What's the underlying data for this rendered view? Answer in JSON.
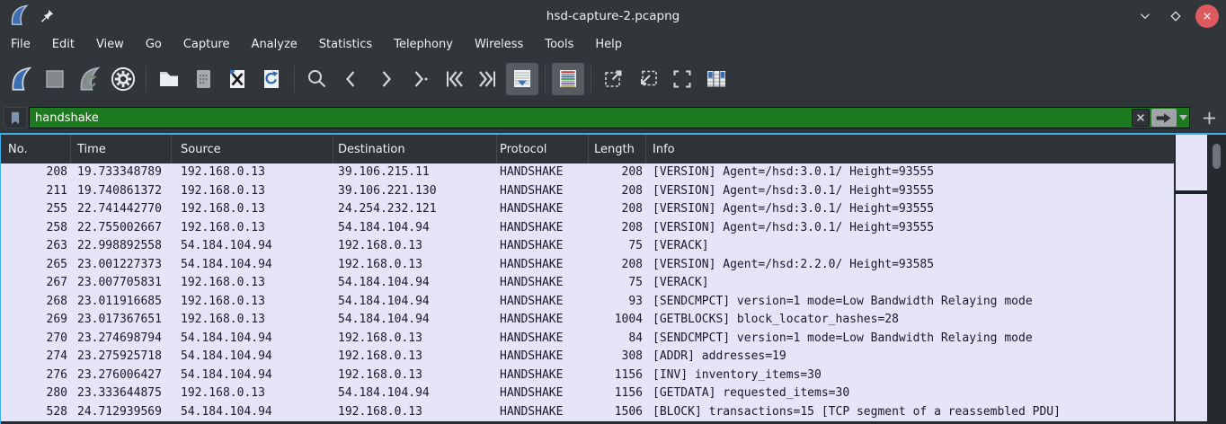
{
  "window": {
    "title": "hsd-capture-2.pcapng",
    "controls": [
      "minimize-icon",
      "maximize-icon",
      "close-icon"
    ]
  },
  "menu": {
    "items": [
      "File",
      "Edit",
      "View",
      "Go",
      "Capture",
      "Analyze",
      "Statistics",
      "Telephony",
      "Wireless",
      "Tools",
      "Help"
    ]
  },
  "toolbar": {
    "buttons": [
      {
        "name": "start-capture",
        "icon": "wireshark-fin-icon",
        "enabled": true,
        "toggled": false
      },
      {
        "name": "stop-capture",
        "icon": "stop-square-icon",
        "enabled": false,
        "toggled": false
      },
      {
        "name": "restart-capture",
        "icon": "fin-restart-icon",
        "enabled": false,
        "toggled": false
      },
      {
        "name": "capture-options",
        "icon": "gear-icon",
        "enabled": true,
        "toggled": false
      },
      {
        "name": "open-file",
        "icon": "folder-icon",
        "enabled": true,
        "toggled": false
      },
      {
        "name": "save-file",
        "icon": "save-document-icon",
        "enabled": false,
        "toggled": false
      },
      {
        "name": "close-file",
        "icon": "document-x-icon",
        "enabled": true,
        "toggled": false
      },
      {
        "name": "reload-file",
        "icon": "document-reload-icon",
        "enabled": true,
        "toggled": false
      },
      {
        "name": "find-packet",
        "icon": "magnifier-icon",
        "enabled": true,
        "toggled": false
      },
      {
        "name": "previous-packet",
        "icon": "chevron-left-icon",
        "enabled": true,
        "toggled": false
      },
      {
        "name": "next-packet",
        "icon": "chevron-right-icon",
        "enabled": true,
        "toggled": false
      },
      {
        "name": "go-to-packet",
        "icon": "chevron-right-dot-icon",
        "enabled": true,
        "toggled": false
      },
      {
        "name": "first-packet",
        "icon": "double-chevron-left-icon",
        "enabled": true,
        "toggled": false
      },
      {
        "name": "last-packet",
        "icon": "double-chevron-right-icon",
        "enabled": true,
        "toggled": false
      },
      {
        "name": "auto-scroll",
        "icon": "document-arrow-down-icon",
        "enabled": true,
        "toggled": true
      },
      {
        "name": "colorize",
        "icon": "document-color-stripes-icon",
        "enabled": true,
        "toggled": true
      },
      {
        "name": "zoom-in",
        "icon": "dashed-square-out-icon",
        "enabled": true,
        "toggled": false
      },
      {
        "name": "zoom-out",
        "icon": "dashed-square-in-icon",
        "enabled": true,
        "toggled": false
      },
      {
        "name": "normal-size",
        "icon": "bracket-square-icon",
        "enabled": true,
        "toggled": false
      },
      {
        "name": "resize-columns",
        "icon": "table-columns-icon",
        "enabled": true,
        "toggled": false
      }
    ]
  },
  "filter": {
    "value": "handshake",
    "status": "valid",
    "bookmark_icon": "bookmark-icon",
    "clear_icon": "x-icon",
    "apply_icon": "arrow-right-icon",
    "dropdown_icon": "caret-down-icon",
    "add_icon": "plus-icon"
  },
  "packet_list": {
    "columns": [
      "No.",
      "Time",
      "Source",
      "Destination",
      "Protocol",
      "Length",
      "Info"
    ],
    "rows": [
      {
        "no": "208",
        "time": "19.733348789",
        "source": "192.168.0.13",
        "destination": "39.106.215.11",
        "protocol": "HANDSHAKE",
        "length": "208",
        "info": "[VERSION] Agent=/hsd:3.0.1/ Height=93555"
      },
      {
        "no": "211",
        "time": "19.740861372",
        "source": "192.168.0.13",
        "destination": "39.106.221.130",
        "protocol": "HANDSHAKE",
        "length": "208",
        "info": "[VERSION] Agent=/hsd:3.0.1/ Height=93555"
      },
      {
        "no": "255",
        "time": "22.741442770",
        "source": "192.168.0.13",
        "destination": "24.254.232.121",
        "protocol": "HANDSHAKE",
        "length": "208",
        "info": "[VERSION] Agent=/hsd:3.0.1/ Height=93555"
      },
      {
        "no": "258",
        "time": "22.755002667",
        "source": "192.168.0.13",
        "destination": "54.184.104.94",
        "protocol": "HANDSHAKE",
        "length": "208",
        "info": "[VERSION] Agent=/hsd:3.0.1/ Height=93555"
      },
      {
        "no": "263",
        "time": "22.998892558",
        "source": "54.184.104.94",
        "destination": "192.168.0.13",
        "protocol": "HANDSHAKE",
        "length": "75",
        "info": "[VERACK]"
      },
      {
        "no": "265",
        "time": "23.001227373",
        "source": "54.184.104.94",
        "destination": "192.168.0.13",
        "protocol": "HANDSHAKE",
        "length": "208",
        "info": "[VERSION] Agent=/hsd:2.2.0/ Height=93585"
      },
      {
        "no": "267",
        "time": "23.007705831",
        "source": "192.168.0.13",
        "destination": "54.184.104.94",
        "protocol": "HANDSHAKE",
        "length": "75",
        "info": "[VERACK]"
      },
      {
        "no": "268",
        "time": "23.011916685",
        "source": "192.168.0.13",
        "destination": "54.184.104.94",
        "protocol": "HANDSHAKE",
        "length": "93",
        "info": "[SENDCMPCT] version=1 mode=Low Bandwidth Relaying mode"
      },
      {
        "no": "269",
        "time": "23.017367651",
        "source": "192.168.0.13",
        "destination": "54.184.104.94",
        "protocol": "HANDSHAKE",
        "length": "1004",
        "info": "[GETBLOCKS] block_locator_hashes=28"
      },
      {
        "no": "270",
        "time": "23.274698794",
        "source": "54.184.104.94",
        "destination": "192.168.0.13",
        "protocol": "HANDSHAKE",
        "length": "84",
        "info": "[SENDCMPCT] version=1 mode=Low Bandwidth Relaying mode"
      },
      {
        "no": "274",
        "time": "23.275925718",
        "source": "54.184.104.94",
        "destination": "192.168.0.13",
        "protocol": "HANDSHAKE",
        "length": "308",
        "info": "[ADDR] addresses=19"
      },
      {
        "no": "276",
        "time": "23.276006427",
        "source": "54.184.104.94",
        "destination": "192.168.0.13",
        "protocol": "HANDSHAKE",
        "length": "1156",
        "info": "[INV] inventory_items=30"
      },
      {
        "no": "280",
        "time": "23.333644875",
        "source": "192.168.0.13",
        "destination": "54.184.104.94",
        "protocol": "HANDSHAKE",
        "length": "1156",
        "info": "[GETDATA] requested_items=30"
      },
      {
        "no": "528",
        "time": "24.712939569",
        "source": "54.184.104.94",
        "destination": "192.168.0.13",
        "protocol": "HANDSHAKE",
        "length": "1506",
        "info": "[BLOCK] transactions=15 [TCP segment of a reassembled PDU]"
      }
    ]
  },
  "colors": {
    "accent": "#3daee9",
    "chrome_bg": "#31363b",
    "filter_valid_bg": "#1e7a1e",
    "handshake_row_bg": "#e5e4f9",
    "close_button": "#dd5a61"
  }
}
